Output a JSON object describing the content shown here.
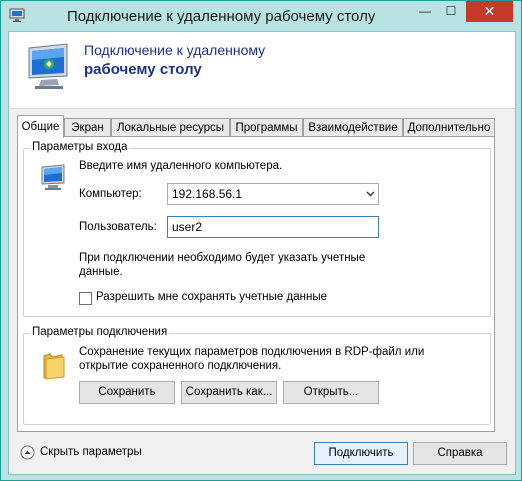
{
  "window": {
    "title": "Подключение к удаленному рабочему столу",
    "minimize_glyph": "—",
    "maximize_glyph": "☐",
    "close_glyph": "✕"
  },
  "banner": {
    "line1": "Подключение к удаленному",
    "line2": "рабочему столу",
    "icon": "remote-desktop-monitor-icon"
  },
  "tabs": [
    {
      "label": "Общие",
      "active": true
    },
    {
      "label": "Экран",
      "active": false
    },
    {
      "label": "Локальные ресурсы",
      "active": false
    },
    {
      "label": "Программы",
      "active": false
    },
    {
      "label": "Взаимодействие",
      "active": false
    },
    {
      "label": "Дополнительно",
      "active": false
    }
  ],
  "login_group": {
    "title": "Параметры входа",
    "hint": "Введите имя удаленного компьютера.",
    "computer_label": "Компьютер:",
    "computer_value": "192.168.56.1",
    "user_label": "Пользователь:",
    "user_value": "user2",
    "note_line1": "При подключении необходимо будет указать учетные",
    "note_line2": "данные.",
    "save_creds_label": "Разрешить мне сохранять учетные данные",
    "save_creds_checked": false
  },
  "connection_group": {
    "title": "Параметры подключения",
    "desc_line1": "Сохранение текущих параметров подключения в RDP-файл или",
    "desc_line2": "открытие сохраненного подключения.",
    "save_button": "Сохранить",
    "save_as_button": "Сохранить как...",
    "open_button": "Открыть..."
  },
  "footer": {
    "hide_options": "Скрыть параметры",
    "connect_button": "Подключить",
    "help_button": "Справка"
  },
  "colors": {
    "title_bar": "#b9e3e3",
    "close_button": "#c73a2b",
    "banner_text": "#1e3287",
    "focus_border": "#3c7fb1"
  }
}
